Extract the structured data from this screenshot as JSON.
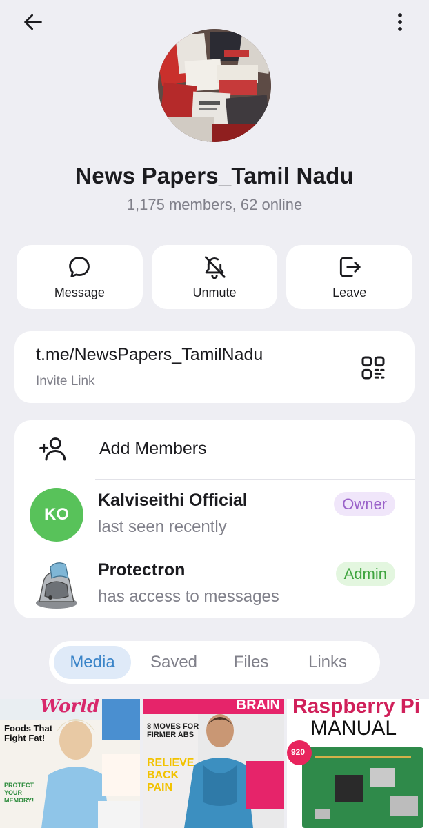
{
  "group": {
    "title": "News Papers_Tamil Nadu",
    "subtitle": "1,175 members, 62 online"
  },
  "actions": [
    {
      "label": "Message",
      "icon": "message-icon"
    },
    {
      "label": "Unmute",
      "icon": "bell-off-icon"
    },
    {
      "label": "Leave",
      "icon": "leave-icon"
    }
  ],
  "invite": {
    "link": "t.me/NewsPapers_TamilNadu",
    "label": "Invite Link"
  },
  "members": {
    "add_label": "Add Members",
    "list": [
      {
        "initials": "KO",
        "name": "Kalviseithi Official",
        "status": "last seen recently",
        "role": "Owner"
      },
      {
        "name": "Protectron",
        "status": "has access to messages",
        "role": "Admin"
      }
    ]
  },
  "tabs": [
    {
      "label": "Media",
      "active": true
    },
    {
      "label": "Saved",
      "active": false
    },
    {
      "label": "Files",
      "active": false
    },
    {
      "label": "Links",
      "active": false
    }
  ],
  "media": [
    {
      "cover_title": "World",
      "headline": "Foods That Fight Fat!",
      "sub": "PROTECT YOUR MEMORY!"
    },
    {
      "cover_title": "BRAIN",
      "headline": "8 MOVES FOR FIRMER ABS",
      "sub": "RELIEVE BACK PAIN"
    },
    {
      "cover_title": "Raspberry Pi",
      "headline": "MANUAL",
      "sub": "920"
    }
  ],
  "colors": {
    "background": "#eeeef3",
    "accent": "#3a84c8",
    "owner": "#9a62c9",
    "admin": "#3ea43e",
    "ko_avatar": "#58c25a"
  }
}
